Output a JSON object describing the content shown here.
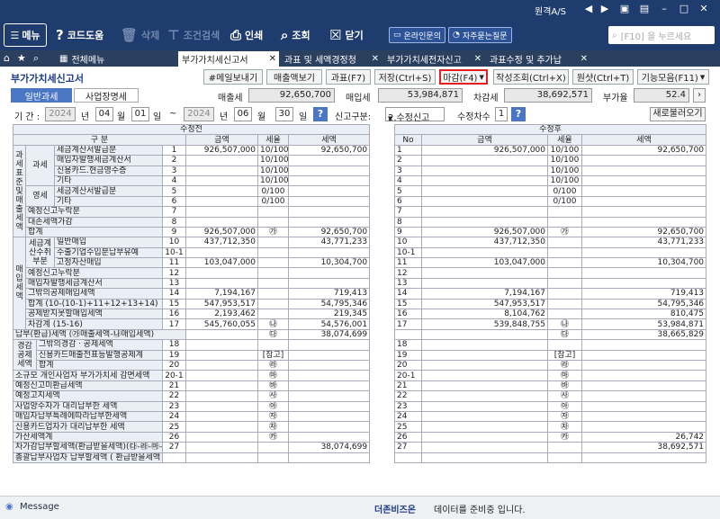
{
  "window": {
    "company": "원격A/S"
  },
  "toolbar": {
    "menu": "메뉴",
    "code_help": "코드도움",
    "delete": "삭제",
    "condition_search": "조건검색",
    "print": "인쇄",
    "inquiry": "조회",
    "close": "닫기",
    "online_inquiry": "온라인문의",
    "faq": "자주묻는질문",
    "search_placeholder": "[F10] 을 누르세요"
  },
  "tabs": [
    {
      "label": "전체메뉴"
    },
    {
      "label": "부가가치세신고서"
    },
    {
      "label": "과표 및 세액경정청"
    },
    {
      "label": "부가가치세전자신고"
    },
    {
      "label": "과표수정 및 추가납"
    }
  ],
  "form": {
    "title": "부가가치세신고서",
    "buttons": {
      "mail": "#메일보내기",
      "email_view": "매출액보기",
      "tax_base": "과표(F7)",
      "save": "저장(Ctrl+S)",
      "close": "마감(F4)",
      "write_view": "작성조회(Ctrl+X)",
      "original": "원샷(Ctrl+T)",
      "func": "기능모음(F11)"
    }
  },
  "subtabs": {
    "general": "일반과세",
    "branch": "사업장명세"
  },
  "summary": {
    "sales_tax_label": "매출세",
    "sales_tax": "92,650,700",
    "purchase_tax_label": "매입세",
    "purchase_tax": "53,984,871",
    "diff_label": "차감세",
    "diff": "38,692,571",
    "vat_rate_label": "부가율",
    "vat_rate": "52.4"
  },
  "period": {
    "label": "기 간 :",
    "from_year": "2024",
    "from_year_unit": "년",
    "from_month": "04",
    "month_unit": "월",
    "from_day": "01",
    "day_unit": "일",
    "tilde": "~",
    "to_year": "2024",
    "to_year_unit": "년",
    "to_month": "06",
    "to_month_unit": "월",
    "to_day": "30",
    "to_day_unit": "일",
    "report_type_label": "신고구분:",
    "report_type": "2.수정신고",
    "revision_label": "수정차수",
    "revision": "1",
    "reload": "새로불러오기"
  },
  "left": {
    "title": "수정전",
    "headers": {
      "category": "구  분",
      "amount": "금액",
      "rate": "세율",
      "tax": "세액"
    }
  },
  "right": {
    "title": "수정후",
    "headers": {
      "no": "No",
      "amount": "금액",
      "rate": "세율",
      "tax": "세액"
    }
  },
  "groups": {
    "taxbase": "과세표준및매출세액",
    "tax": "과세",
    "zero": "영세",
    "purchase": "매입세액",
    "purchase_sub": "세금계산수취부분",
    "deduct": "경감공제세액"
  },
  "rows": [
    {
      "label": "세금계산서발급분",
      "no": "1",
      "amt": "926,507,000",
      "rate": "10/100",
      "tax": "92,650,700",
      "ano": "1",
      "aamt": "926,507,000",
      "arate": "10/100",
      "atax": "92,650,700"
    },
    {
      "label": "매입자발행세금계산서",
      "no": "2",
      "amt": "",
      "rate": "10/100",
      "tax": "",
      "ano": "2",
      "aamt": "",
      "arate": "10/100",
      "atax": ""
    },
    {
      "label": "신용카드.현금영수증",
      "no": "3",
      "amt": "",
      "rate": "10/100",
      "tax": "",
      "ano": "3",
      "aamt": "",
      "arate": "10/100",
      "atax": ""
    },
    {
      "label": "기타",
      "no": "4",
      "amt": "",
      "rate": "10/100",
      "tax": "",
      "ano": "4",
      "aamt": "",
      "arate": "10/100",
      "atax": ""
    },
    {
      "label": "세금계산서발급분",
      "no": "5",
      "amt": "",
      "rate": "0/100",
      "tax": "",
      "ano": "5",
      "aamt": "",
      "arate": "0/100",
      "atax": ""
    },
    {
      "label": "기타",
      "no": "6",
      "amt": "",
      "rate": "0/100",
      "tax": "",
      "ano": "6",
      "aamt": "",
      "arate": "0/100",
      "atax": ""
    },
    {
      "label": "예정신고누락분",
      "no": "7",
      "amt": "",
      "rate": "",
      "tax": "",
      "ano": "7",
      "aamt": "",
      "arate": "",
      "atax": ""
    },
    {
      "label": "대손세액가감",
      "no": "8",
      "amt": "",
      "rate": "",
      "tax": "",
      "ano": "8",
      "aamt": "",
      "arate": "",
      "atax": ""
    },
    {
      "label": "합계",
      "no": "9",
      "amt": "926,507,000",
      "rate": "㉮",
      "tax": "92,650,700",
      "ano": "9",
      "aamt": "926,507,000",
      "arate": "㉮",
      "atax": "92,650,700"
    },
    {
      "label": "일반매입",
      "no": "10",
      "amt": "437,712,350",
      "rate": "",
      "tax": "43,771,233",
      "ano": "10",
      "aamt": "437,712,350",
      "arate": "",
      "atax": "43,771,233"
    },
    {
      "label": "수출기업수입분납부유예",
      "no": "10-1",
      "amt": "",
      "rate": "",
      "tax": "",
      "ano": "10-1",
      "aamt": "",
      "arate": "",
      "atax": ""
    },
    {
      "label": "고정자산매입",
      "no": "11",
      "amt": "103,047,000",
      "rate": "",
      "tax": "10,304,700",
      "ano": "11",
      "aamt": "103,047,000",
      "arate": "",
      "atax": "10,304,700"
    },
    {
      "label": "예정신고누락분",
      "no": "12",
      "amt": "",
      "rate": "",
      "tax": "",
      "ano": "12",
      "aamt": "",
      "arate": "",
      "atax": ""
    },
    {
      "label": "매입자발행세금계산서",
      "no": "13",
      "amt": "",
      "rate": "",
      "tax": "",
      "ano": "13",
      "aamt": "",
      "arate": "",
      "atax": ""
    },
    {
      "label": "그밖의공제매입세액",
      "no": "14",
      "amt": "7,194,167",
      "rate": "",
      "tax": "719,413",
      "ano": "14",
      "aamt": "7,194,167",
      "arate": "",
      "atax": "719,413"
    },
    {
      "label": "합계 (10-(10-1)+11+12+13+14)",
      "no": "15",
      "amt": "547,953,517",
      "rate": "",
      "tax": "54,795,346",
      "ano": "15",
      "aamt": "547,953,517",
      "arate": "",
      "atax": "54,795,346"
    },
    {
      "label": "공제받지못할매입세액",
      "no": "16",
      "amt": "2,193,462",
      "rate": "",
      "tax": "219,345",
      "ano": "16",
      "aamt": "8,104,762",
      "arate": "",
      "atax": "810,475"
    },
    {
      "label": "차감계 (15-16)",
      "no": "17",
      "amt": "545,760,055",
      "rate": "㉯",
      "tax": "54,576,001",
      "ano": "17",
      "aamt": "539,848,755",
      "arate": "㉯",
      "atax": "53,984,871"
    },
    {
      "label": "납부(환급)세액 (㉮매출세액-㉯매입세액)",
      "no": "",
      "amt": "",
      "rate": "㉰",
      "tax": "38,074,699",
      "ano": "",
      "aamt": "",
      "arate": "㉰",
      "atax": "38,665,829"
    },
    {
      "label": "그밖의경감ㆍ공제세액",
      "no": "18",
      "amt": "",
      "rate": "",
      "tax": "",
      "ano": "18",
      "aamt": "",
      "arate": "",
      "atax": ""
    },
    {
      "label": "신용카드매출전표등발행공제계",
      "no": "19",
      "amt": "",
      "rate": "[참고]",
      "tax": "",
      "ano": "19",
      "aamt": "",
      "arate": "[참고]",
      "atax": ""
    },
    {
      "label": "합계",
      "no": "20",
      "amt": "",
      "rate": "㉱",
      "tax": "",
      "ano": "20",
      "aamt": "",
      "arate": "㉱",
      "atax": ""
    },
    {
      "label": "소규모 개인사업자 부가가치세 감면세액",
      "no": "20-1",
      "amt": "",
      "rate": "㉲",
      "tax": "",
      "ano": "20-1",
      "aamt": "",
      "arate": "㉲",
      "atax": ""
    },
    {
      "label": "예정신고미환급세액",
      "no": "21",
      "amt": "",
      "rate": "㉳",
      "tax": "",
      "ano": "21",
      "aamt": "",
      "arate": "㉳",
      "atax": ""
    },
    {
      "label": "예정고지세액",
      "no": "22",
      "amt": "",
      "rate": "㉴",
      "tax": "",
      "ano": "22",
      "aamt": "",
      "arate": "㉴",
      "atax": ""
    },
    {
      "label": "사업양수자가 대리납부한 세액",
      "no": "23",
      "amt": "",
      "rate": "㉵",
      "tax": "",
      "ano": "23",
      "aamt": "",
      "arate": "㉵",
      "atax": ""
    },
    {
      "label": "매입자납부특례에따라납부한세액",
      "no": "24",
      "amt": "",
      "rate": "㉶",
      "tax": "",
      "ano": "24",
      "aamt": "",
      "arate": "㉶",
      "atax": ""
    },
    {
      "label": "신용카드업자가 대리납부한 세액",
      "no": "25",
      "amt": "",
      "rate": "㉷",
      "tax": "",
      "ano": "25",
      "aamt": "",
      "arate": "㉷",
      "atax": ""
    },
    {
      "label": "가산세액계",
      "no": "26",
      "amt": "",
      "rate": "㉸",
      "tax": "",
      "ano": "26",
      "aamt": "",
      "arate": "㉸",
      "atax": "26,742"
    },
    {
      "label": "차가감납부할세액(환급받을세액)(㉰-㉱-㉲-㉳-㉴-㉵-㉶-㉷+㉸)",
      "no": "27",
      "amt": "",
      "rate": "",
      "tax": "38,074,699",
      "ano": "27",
      "aamt": "",
      "arate": "",
      "atax": "38,692,571"
    },
    {
      "label": "총괄납부사업자 납부할세액 ( 환급받을세액 )",
      "no": "",
      "amt": "",
      "rate": "",
      "tax": "",
      "ano": "",
      "aamt": "",
      "arate": "",
      "atax": ""
    }
  ],
  "statusbar": {
    "message": "Message",
    "brand": "더존비즈온",
    "status": "데이터를 준비중 입니다."
  }
}
